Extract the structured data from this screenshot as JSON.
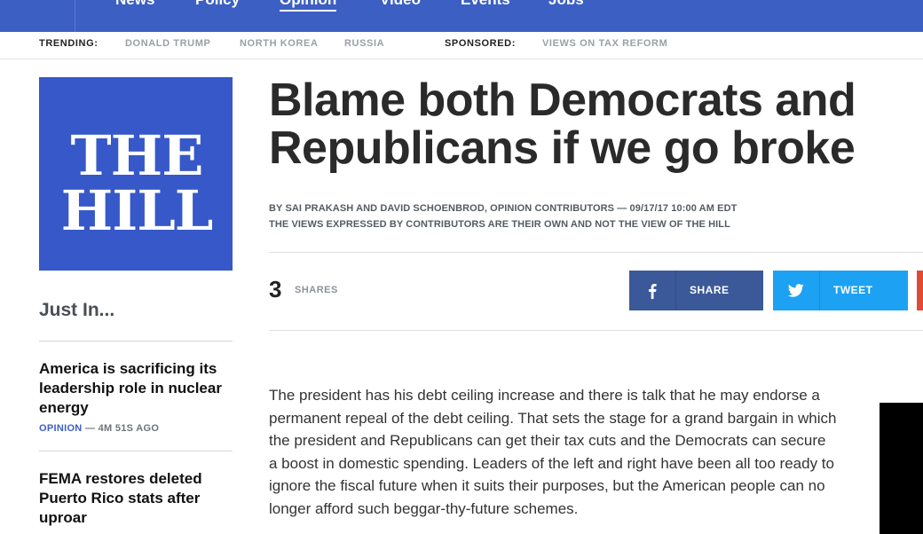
{
  "nav": {
    "items": [
      "News",
      "Policy",
      "Opinion",
      "Video",
      "Events",
      "Jobs"
    ],
    "active": "Opinion"
  },
  "trending": {
    "label": "TRENDING:",
    "links": [
      "DONALD TRUMP",
      "NORTH KOREA",
      "RUSSIA"
    ],
    "sponsored_label": "SPONSORED:",
    "sponsored_link": "VIEWS ON TAX REFORM"
  },
  "logo": {
    "line1": "THE",
    "line2": "HILL"
  },
  "sidebar": {
    "title": "Just In...",
    "items": [
      {
        "headline": "America is sacrificing its leadership role in nuclear energy",
        "category": "OPINION",
        "time": "— 4M 51S AGO"
      },
      {
        "headline": "FEMA restores deleted Puerto Rico stats after uproar"
      }
    ]
  },
  "article": {
    "headline": "Blame both Democrats and Republicans if we go broke",
    "byline": "BY SAI PRAKASH AND DAVID SCHOENBROD, OPINION CONTRIBUTORS — 09/17/17 10:00 AM EDT",
    "disclaimer": "THE VIEWS EXPRESSED BY CONTRIBUTORS ARE THEIR OWN AND NOT THE VIEW OF THE HILL",
    "share_count": "3",
    "share_label": "SHARES",
    "facebook_label": "SHARE",
    "twitter_label": "TWEET",
    "body": "The president has his debt ceiling increase and there is talk that he may endorse a permanent repeal of the debt ceiling. That sets the stage for a grand bargain in which the president and Republicans can get their tax cuts and the Democrats can secure a boost in domestic spending. Leaders of the left and right have been all too ready to ignore the fiscal future when it suits their purposes, but the American people can no longer afford such beggar-thy-future schemes."
  },
  "colors": {
    "brand_blue": "#3c5fc4",
    "facebook": "#3b5998",
    "twitter": "#1da1f2",
    "email": "#e04b37"
  },
  "icons": [
    "menu-icon",
    "facebook-icon",
    "twitter-icon"
  ]
}
